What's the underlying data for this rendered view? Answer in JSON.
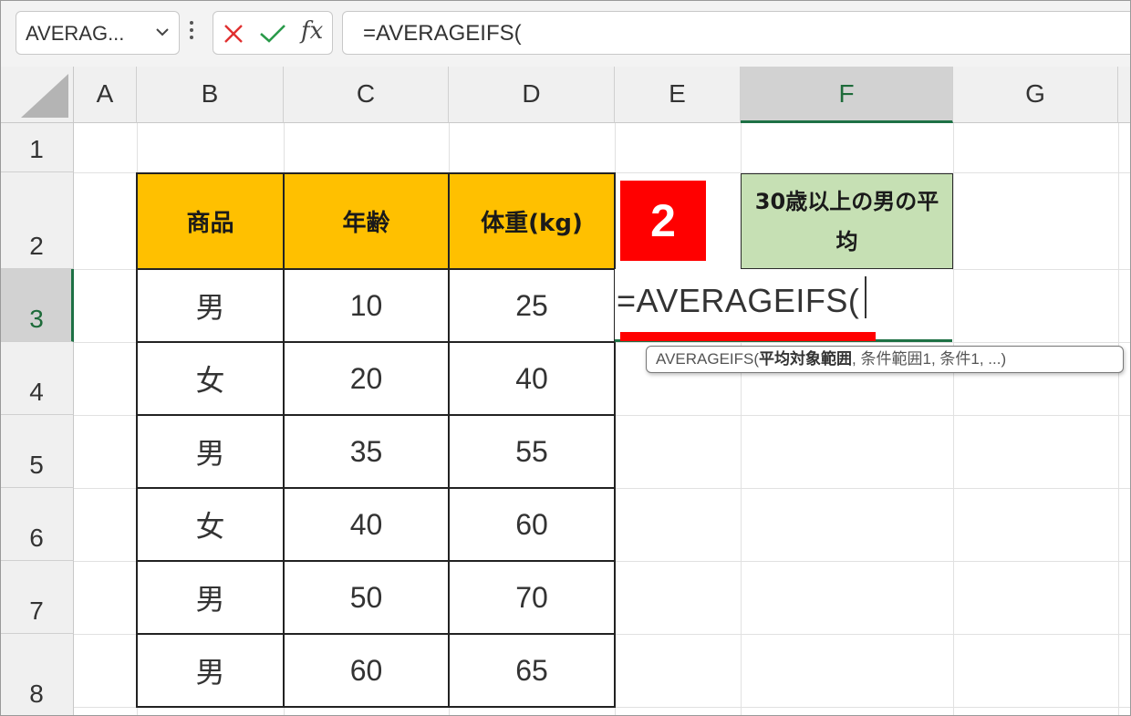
{
  "formula_bar": {
    "name_box": "AVERAG...",
    "cancel_icon": "x-icon",
    "enter_icon": "check-icon",
    "function_label": "fx",
    "formula": "=AVERAGEIFS("
  },
  "columns": [
    "A",
    "B",
    "C",
    "D",
    "E",
    "F",
    "G"
  ],
  "selected_column": "F",
  "rows": [
    "1",
    "2",
    "3",
    "4",
    "5",
    "6",
    "7",
    "8"
  ],
  "selected_row": "3",
  "table": {
    "headers": [
      "商品",
      "年齢",
      "体重(kg)"
    ],
    "rows": [
      [
        "男",
        "10",
        "25"
      ],
      [
        "女",
        "20",
        "40"
      ],
      [
        "男",
        "35",
        "55"
      ],
      [
        "女",
        "40",
        "60"
      ],
      [
        "男",
        "50",
        "70"
      ],
      [
        "男",
        "60",
        "65"
      ]
    ]
  },
  "step_badge": "2",
  "average_label": "30歳以上の男の平均",
  "edit_cell_text": "=AVERAGEIFS(",
  "tooltip": {
    "prefix": "AVERAGEIFS(",
    "bold_arg": "平均対象範囲",
    "rest": ", 条件範囲1, 条件1, ...)"
  },
  "colors": {
    "header_fill": "#ffc000",
    "label_fill": "#c6e0b4",
    "badge": "#ff0000",
    "selection": "#1e7145"
  }
}
